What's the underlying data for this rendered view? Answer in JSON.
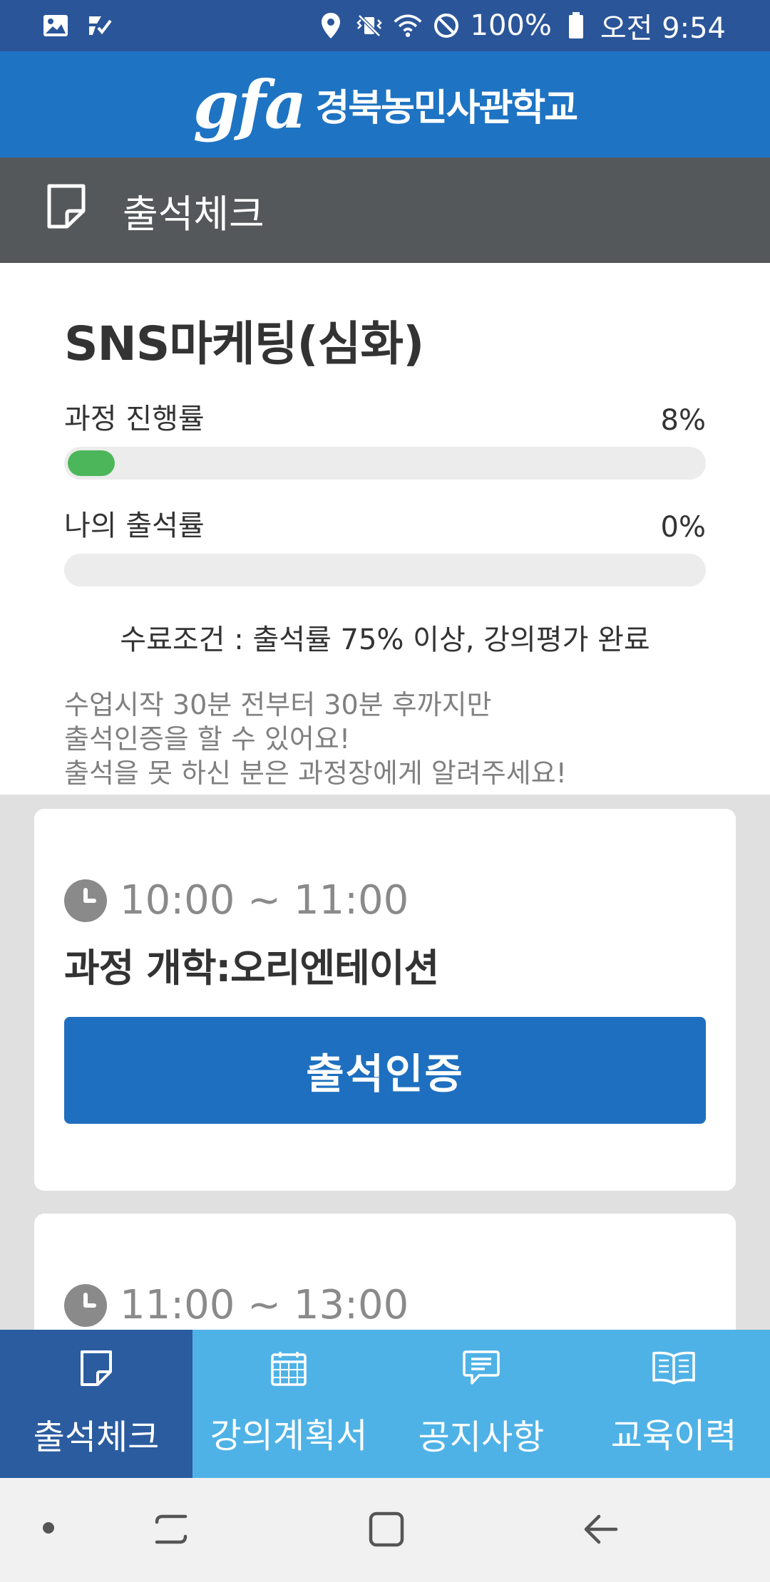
{
  "status_bar": {
    "battery": "100%",
    "time": "오전 9:54"
  },
  "app_bar": {
    "logo_mark": "gfa",
    "logo_text": "경북농민사관학교"
  },
  "page_header": {
    "title": "출석체크",
    "icon": "note-icon"
  },
  "summary": {
    "course_title": "SNS마케팅(심화)",
    "progress": {
      "label": "과정 진행률",
      "value_text": "8%",
      "value": 8
    },
    "attendance": {
      "label": "나의 출석률",
      "value_text": "0%",
      "value": 0
    },
    "completion_condition": "수료조건 : 출석률 75% 이상, 강의평가 완료",
    "notice_lines": [
      "수업시작 30분 전부터 30분 후까지만",
      "출석인증을 할 수 있어요!",
      "출석을 못 하신 분은 과정장에게 알려주세요!"
    ],
    "colors": {
      "progress_fill": "#4cb75a",
      "bar_track": "#ececec"
    }
  },
  "sessions": [
    {
      "time": "10:00 ~ 11:00",
      "title": "과정 개학:오리엔테이션",
      "button_label": "출석인증"
    },
    {
      "time": "11:00 ~ 13:00"
    }
  ],
  "bottom_nav": {
    "items": [
      {
        "label": "출석체크",
        "icon": "note-icon",
        "active": true
      },
      {
        "label": "강의계획서",
        "icon": "calendar-icon",
        "active": false
      },
      {
        "label": "공지사항",
        "icon": "chat-bubble-icon",
        "active": false
      },
      {
        "label": "교육이력",
        "icon": "open-book-icon",
        "active": false
      }
    ],
    "colors": {
      "background": "#4fb2e6",
      "active": "#2b5c9f"
    }
  },
  "colors": {
    "status_bar": "#2a5599",
    "app_bar": "#1e73c3",
    "page_header": "#55585a",
    "primary_button": "#1e6fbf"
  }
}
